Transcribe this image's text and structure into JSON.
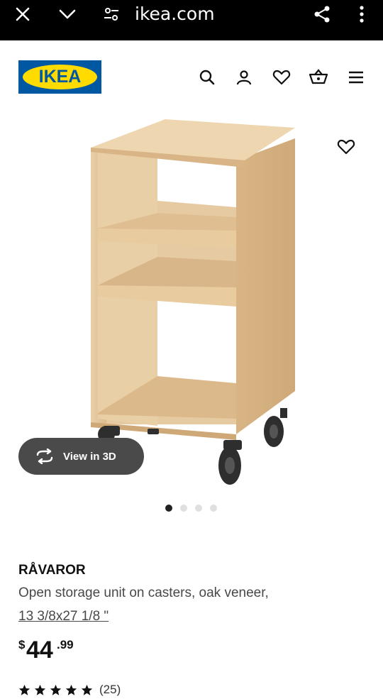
{
  "browser": {
    "url": "ikea.com",
    "icons": [
      "close-icon",
      "chevron-down-icon",
      "site-settings-icon",
      "share-icon",
      "more-vert-icon"
    ]
  },
  "header": {
    "logo_text": "IKEA",
    "icons": [
      "search-icon",
      "user-icon",
      "heart-icon",
      "cart-icon",
      "menu-icon"
    ],
    "colors": {
      "logo_blue": "#0058a3",
      "logo_yellow": "#ffdb00"
    }
  },
  "gallery": {
    "view_3d_label": "View in 3D",
    "active_index": 0,
    "total_images": 4
  },
  "product": {
    "name": "RÅVAROR",
    "description": "Open storage unit on casters, oak veneer,",
    "size": "13 3/8x27 1/8 \"",
    "price": {
      "currency": "$",
      "integer": "44",
      "decimal": ".99"
    },
    "rating": {
      "stars": 5,
      "count": "(25)"
    }
  }
}
